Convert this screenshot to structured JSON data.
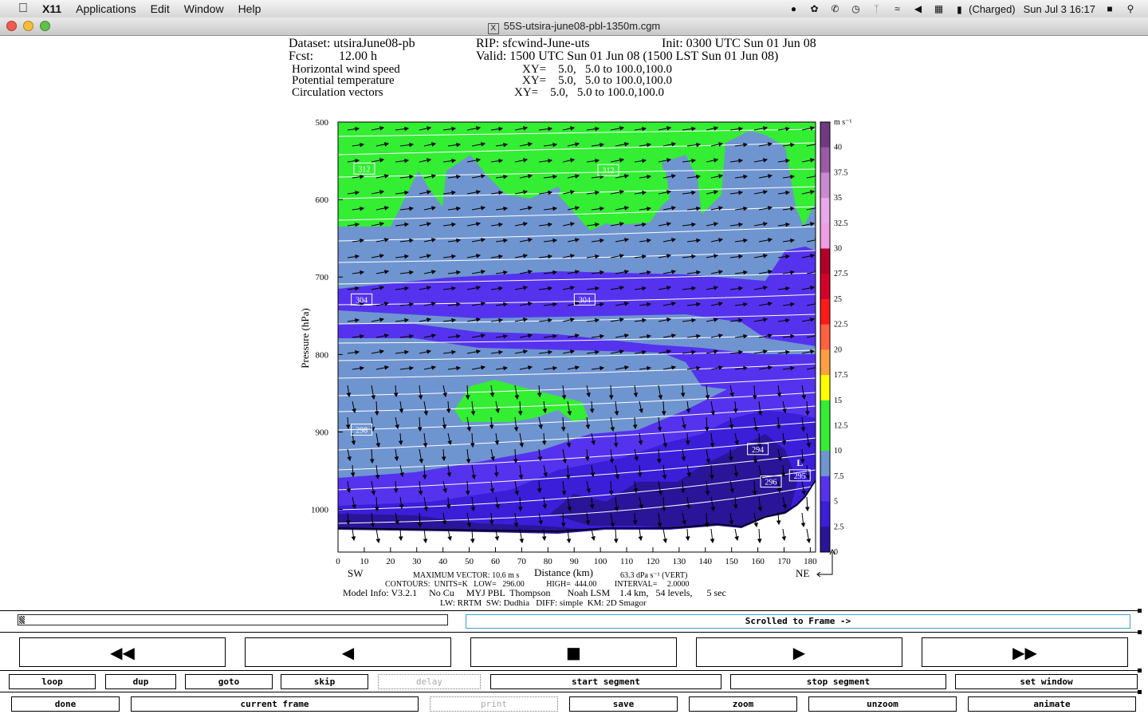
{
  "menubar": {
    "app_name": "X11",
    "items": [
      "Applications",
      "Edit",
      "Window",
      "Help"
    ],
    "battery_text": "(Charged)",
    "clock": "Sun Jul 3  16:17"
  },
  "window": {
    "title": "55S-utsira-june08-pbl-1350m.cgm"
  },
  "plot": {
    "header": {
      "dataset": "Dataset: utsiraJune08-pb",
      "rip": "RIP: sfcwind-June-uts",
      "init": "Init: 0300 UTC Sun 01 Jun 08",
      "fcst_label": "Fcst:",
      "fcst_value": "12.00 h",
      "valid": "Valid: 1500 UTC Sun 01 Jun 08 (1500 LST Sun 01 Jun 08)",
      "fields": [
        {
          "name": "Horizontal wind speed",
          "xy": "XY=    5.0,   5.0 to 100.0,100.0"
        },
        {
          "name": "Potential temperature",
          "xy": "XY=    5.0,   5.0 to 100.0,100.0"
        },
        {
          "name": "Circulation vectors",
          "xy": "XY=    5.0,   5.0 to 100.0,100.0"
        }
      ]
    },
    "footer": {
      "sw": "SW",
      "ne": "NE",
      "max_vector": "MAXIMUM VECTOR:  10.6 m s",
      "max_vector_tail": "63.3 dPa s⁻¹ (VERT)",
      "contours": "CONTOURS:  UNITS=K   LOW=   296.00           HIGH=  444.00         INTERVAL=     2.0000",
      "model_info": "Model Info: V3.2.1     No Cu     MYJ PBL  Thompson       Noah LSM    1.4 km,   54 levels,      5 sec",
      "model_info2": "LW: RRTM  SW: Dudhia   DIFF: simple  KM: 2D Smagor"
    },
    "contour_labels": [
      "312",
      "312",
      "304",
      "304",
      "298",
      "294",
      "296",
      "L",
      "295"
    ],
    "colorbar": {
      "unit": "m s⁻¹",
      "levels": [
        "40",
        "37.5",
        "35",
        "32.5",
        "30",
        "27.5",
        "25",
        "22.5",
        "20",
        "17.5",
        "15",
        "12.5",
        "10",
        "7.5",
        "5",
        "2.5",
        "0"
      ],
      "colors": [
        "#6e3c7e",
        "#9a5aa6",
        "#c98ad0",
        "#e9a9e9",
        "#ee9ee3",
        "#b0002a",
        "#d4002a",
        "#ff1a1a",
        "#ff6040",
        "#ffa040",
        "#ffff00",
        "#33ee33",
        "#33ee33",
        "#6f95d0",
        "#5533ee",
        "#3a1ed8",
        "#2a1497"
      ]
    }
  },
  "chart_data": {
    "type": "heatmap",
    "title": "",
    "xlabel": "Distance (km)",
    "ylabel": "Pressure (hPa)",
    "x_ticks": [
      0,
      10,
      20,
      30,
      40,
      50,
      60,
      70,
      80,
      90,
      100,
      110,
      120,
      130,
      140,
      150,
      160,
      170,
      180
    ],
    "y_ticks": [
      500,
      600,
      700,
      800,
      900,
      1000
    ],
    "xlim": [
      0,
      182
    ],
    "ylim": [
      500,
      1055
    ],
    "y_inverted": true,
    "grid": false,
    "legend": "right-colorbar",
    "colorbar_levels": [
      0,
      2.5,
      5,
      7.5,
      10,
      12.5,
      15,
      17.5,
      20,
      22.5,
      25,
      27.5,
      30,
      32.5,
      35,
      37.5,
      40
    ],
    "contour_annotations": [
      {
        "x": 10,
        "y": 560,
        "label": "312"
      },
      {
        "x": 103,
        "y": 562,
        "label": "312"
      },
      {
        "x": 9,
        "y": 729,
        "label": "304"
      },
      {
        "x": 94,
        "y": 729,
        "label": "304"
      },
      {
        "x": 9,
        "y": 897,
        "label": "298"
      },
      {
        "x": 160,
        "y": 922,
        "label": "294"
      },
      {
        "x": 165,
        "y": 964,
        "label": "296"
      },
      {
        "x": 176,
        "y": 956,
        "label": "295"
      }
    ]
  },
  "controls": {
    "frame_label": "Scrolled to Frame ->",
    "transport": [
      {
        "name": "rewind-button",
        "glyph": "◀◀"
      },
      {
        "name": "step-back-button",
        "glyph": "◀"
      },
      {
        "name": "stop-button",
        "glyph": "■"
      },
      {
        "name": "play-button",
        "glyph": "▶"
      },
      {
        "name": "fast-forward-button",
        "glyph": "▶▶"
      }
    ],
    "row1": [
      "loop",
      "dup",
      "goto",
      "skip",
      "delay",
      "start segment",
      "stop segment",
      "set window"
    ],
    "row2": [
      "done",
      "current frame",
      "print",
      "save",
      "zoom",
      "unzoom",
      "animate"
    ]
  }
}
